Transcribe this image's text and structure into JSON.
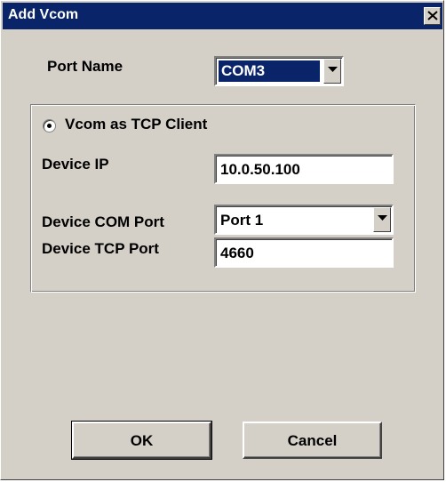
{
  "window": {
    "title": "Add Vcom",
    "close_icon": "close-icon"
  },
  "port_name": {
    "label": "Port Name",
    "value": "COM3",
    "icon": "chevron-down-icon"
  },
  "mode": {
    "radio_label": "Vcom as TCP Client",
    "selected": true
  },
  "device_ip": {
    "label": "Device IP",
    "value": "10.0.50.100"
  },
  "device_com_port": {
    "label": "Device COM Port",
    "value": "Port 1",
    "icon": "chevron-down-icon"
  },
  "device_tcp_port": {
    "label": "Device TCP Port",
    "value": "4660"
  },
  "buttons": {
    "ok": "OK",
    "cancel": "Cancel"
  },
  "colors": {
    "titlebar": "#0a246a",
    "dialog_face": "#d4d0c8",
    "selection": "#0a246a"
  }
}
